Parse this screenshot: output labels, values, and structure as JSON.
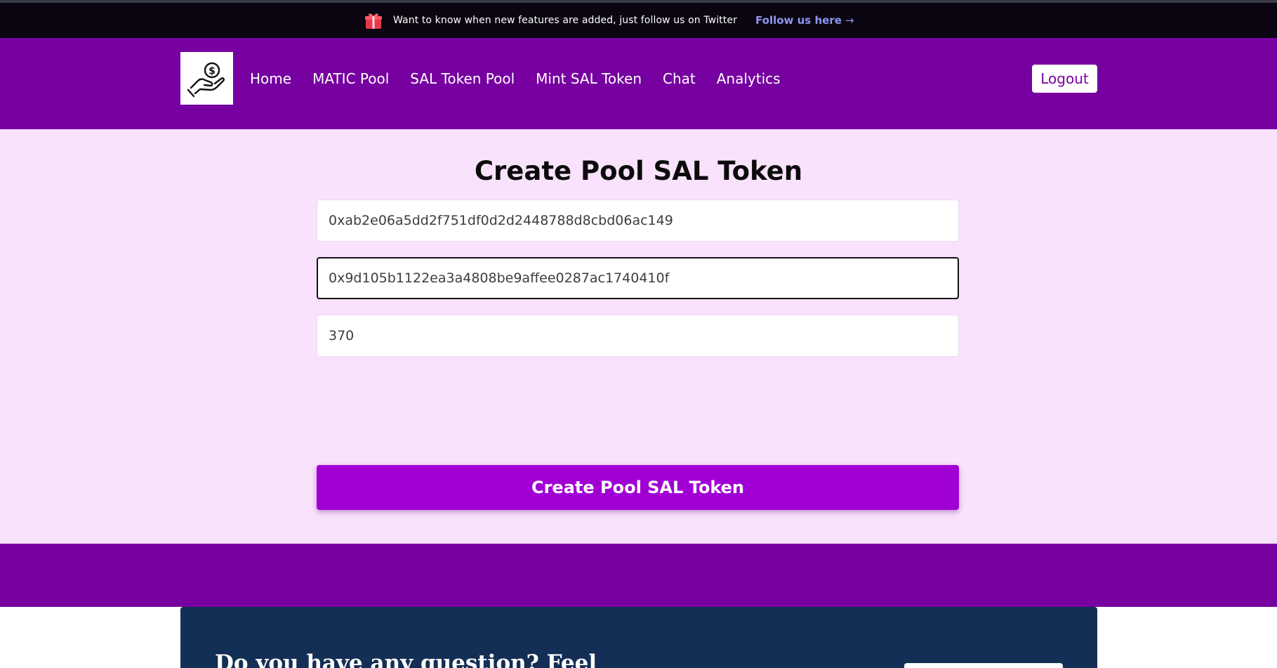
{
  "announcement": {
    "message": "Want to know when new features are added, just follow us on Twitter",
    "follow_label": "Follow us here",
    "follow_arrow": "→"
  },
  "header": {
    "logo_icon": "hand-holding-dollar-icon",
    "nav": [
      {
        "label": "Home"
      },
      {
        "label": "MATIC Pool"
      },
      {
        "label": "SAL Token Pool"
      },
      {
        "label": "Mint SAL Token"
      },
      {
        "label": "Chat"
      },
      {
        "label": "Analytics"
      }
    ],
    "logout_label": "Logout"
  },
  "form": {
    "title": "Create Pool SAL Token",
    "fields": [
      {
        "value": "0xab2e06a5dd2f751df0d2d2448788d8cbd06ac149"
      },
      {
        "value": "0x9d105b1122ea3a4808be9affee0287ac1740410f"
      },
      {
        "value": "370"
      }
    ],
    "submit_label": "Create Pool SAL Token"
  },
  "cta": {
    "question": "Do you have any question? Feel"
  },
  "colors": {
    "header_bg": "#7700a0",
    "main_bg": "#f9e2fc",
    "button_bg": "#a100d5",
    "cta_bg": "#142f55",
    "follow_link": "#8f95f5"
  }
}
